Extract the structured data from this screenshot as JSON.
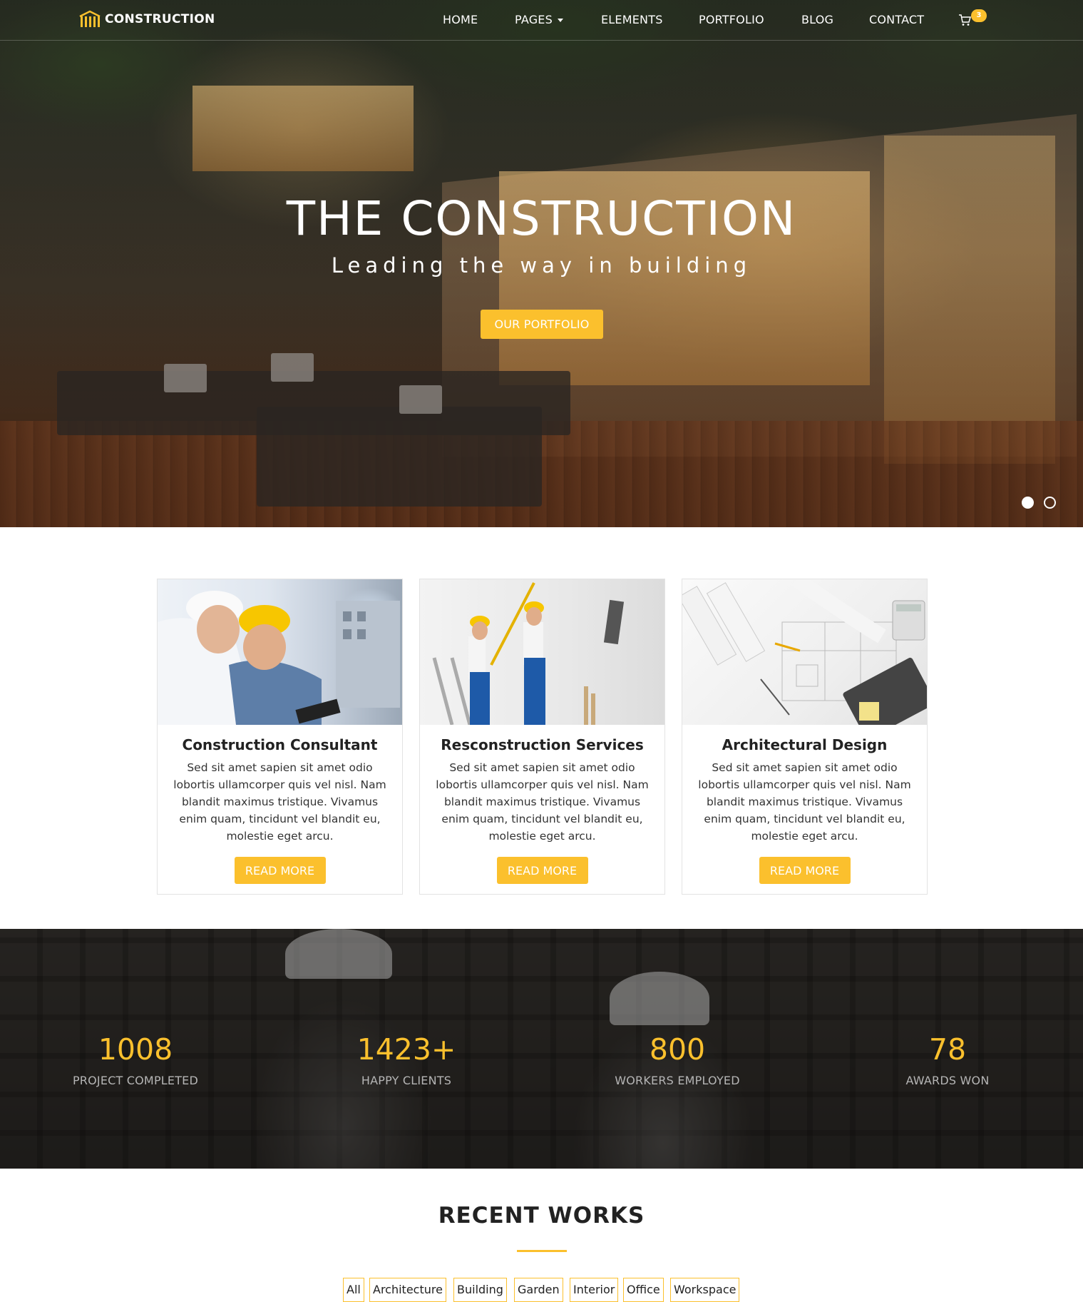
{
  "brand": {
    "name": "CONSTRUCTION"
  },
  "nav": {
    "items": [
      "HOME",
      "PAGES",
      "ELEMENTS",
      "PORTFOLIO",
      "BLOG",
      "CONTACT"
    ],
    "cart_count": "3"
  },
  "hero": {
    "title": "THE CONSTRUCTION",
    "subtitle": "Leading the way in building",
    "button": "OUR PORTFOLIO",
    "slides": 2,
    "active_slide": 1
  },
  "services": [
    {
      "title": "Construction Consultant",
      "text": "Sed sit amet sapien sit amet odio lobortis ullamcorper quis vel nisl. Nam blandit maximus tristique. Vivamus enim quam, tincidunt vel blandit eu, molestie eget arcu.",
      "button": "READ MORE"
    },
    {
      "title": "Resconstruction Services",
      "text": "Sed sit amet sapien sit amet odio lobortis ullamcorper quis vel nisl. Nam blandit maximus tristique. Vivamus enim quam, tincidunt vel blandit eu, molestie eget arcu.",
      "button": "READ MORE"
    },
    {
      "title": "Architectural Design",
      "text": "Sed sit amet sapien sit amet odio lobortis ullamcorper quis vel nisl. Nam blandit maximus tristique. Vivamus enim quam, tincidunt vel blandit eu, molestie eget arcu.",
      "button": "READ MORE"
    }
  ],
  "stats": [
    {
      "value": "1008",
      "label": "PROJECT COMPLETED"
    },
    {
      "value": "1423+",
      "label": "HAPPY CLIENTS"
    },
    {
      "value": "800",
      "label": "WORKERS EMPLOYED"
    },
    {
      "value": "78",
      "label": "AWARDS WON"
    }
  ],
  "recent_works": {
    "title": "RECENT WORKS",
    "filters": [
      "All",
      "Architecture",
      "Building",
      "Garden",
      "Interior",
      "Office",
      "Workspace"
    ]
  },
  "colors": {
    "accent": "#fbc02d",
    "text": "#222222",
    "stat_label": "#b5b5b5"
  },
  "icons": {
    "logo": "building-columns-icon",
    "cart": "shopping-cart-icon",
    "caret": "caret-down-icon"
  }
}
